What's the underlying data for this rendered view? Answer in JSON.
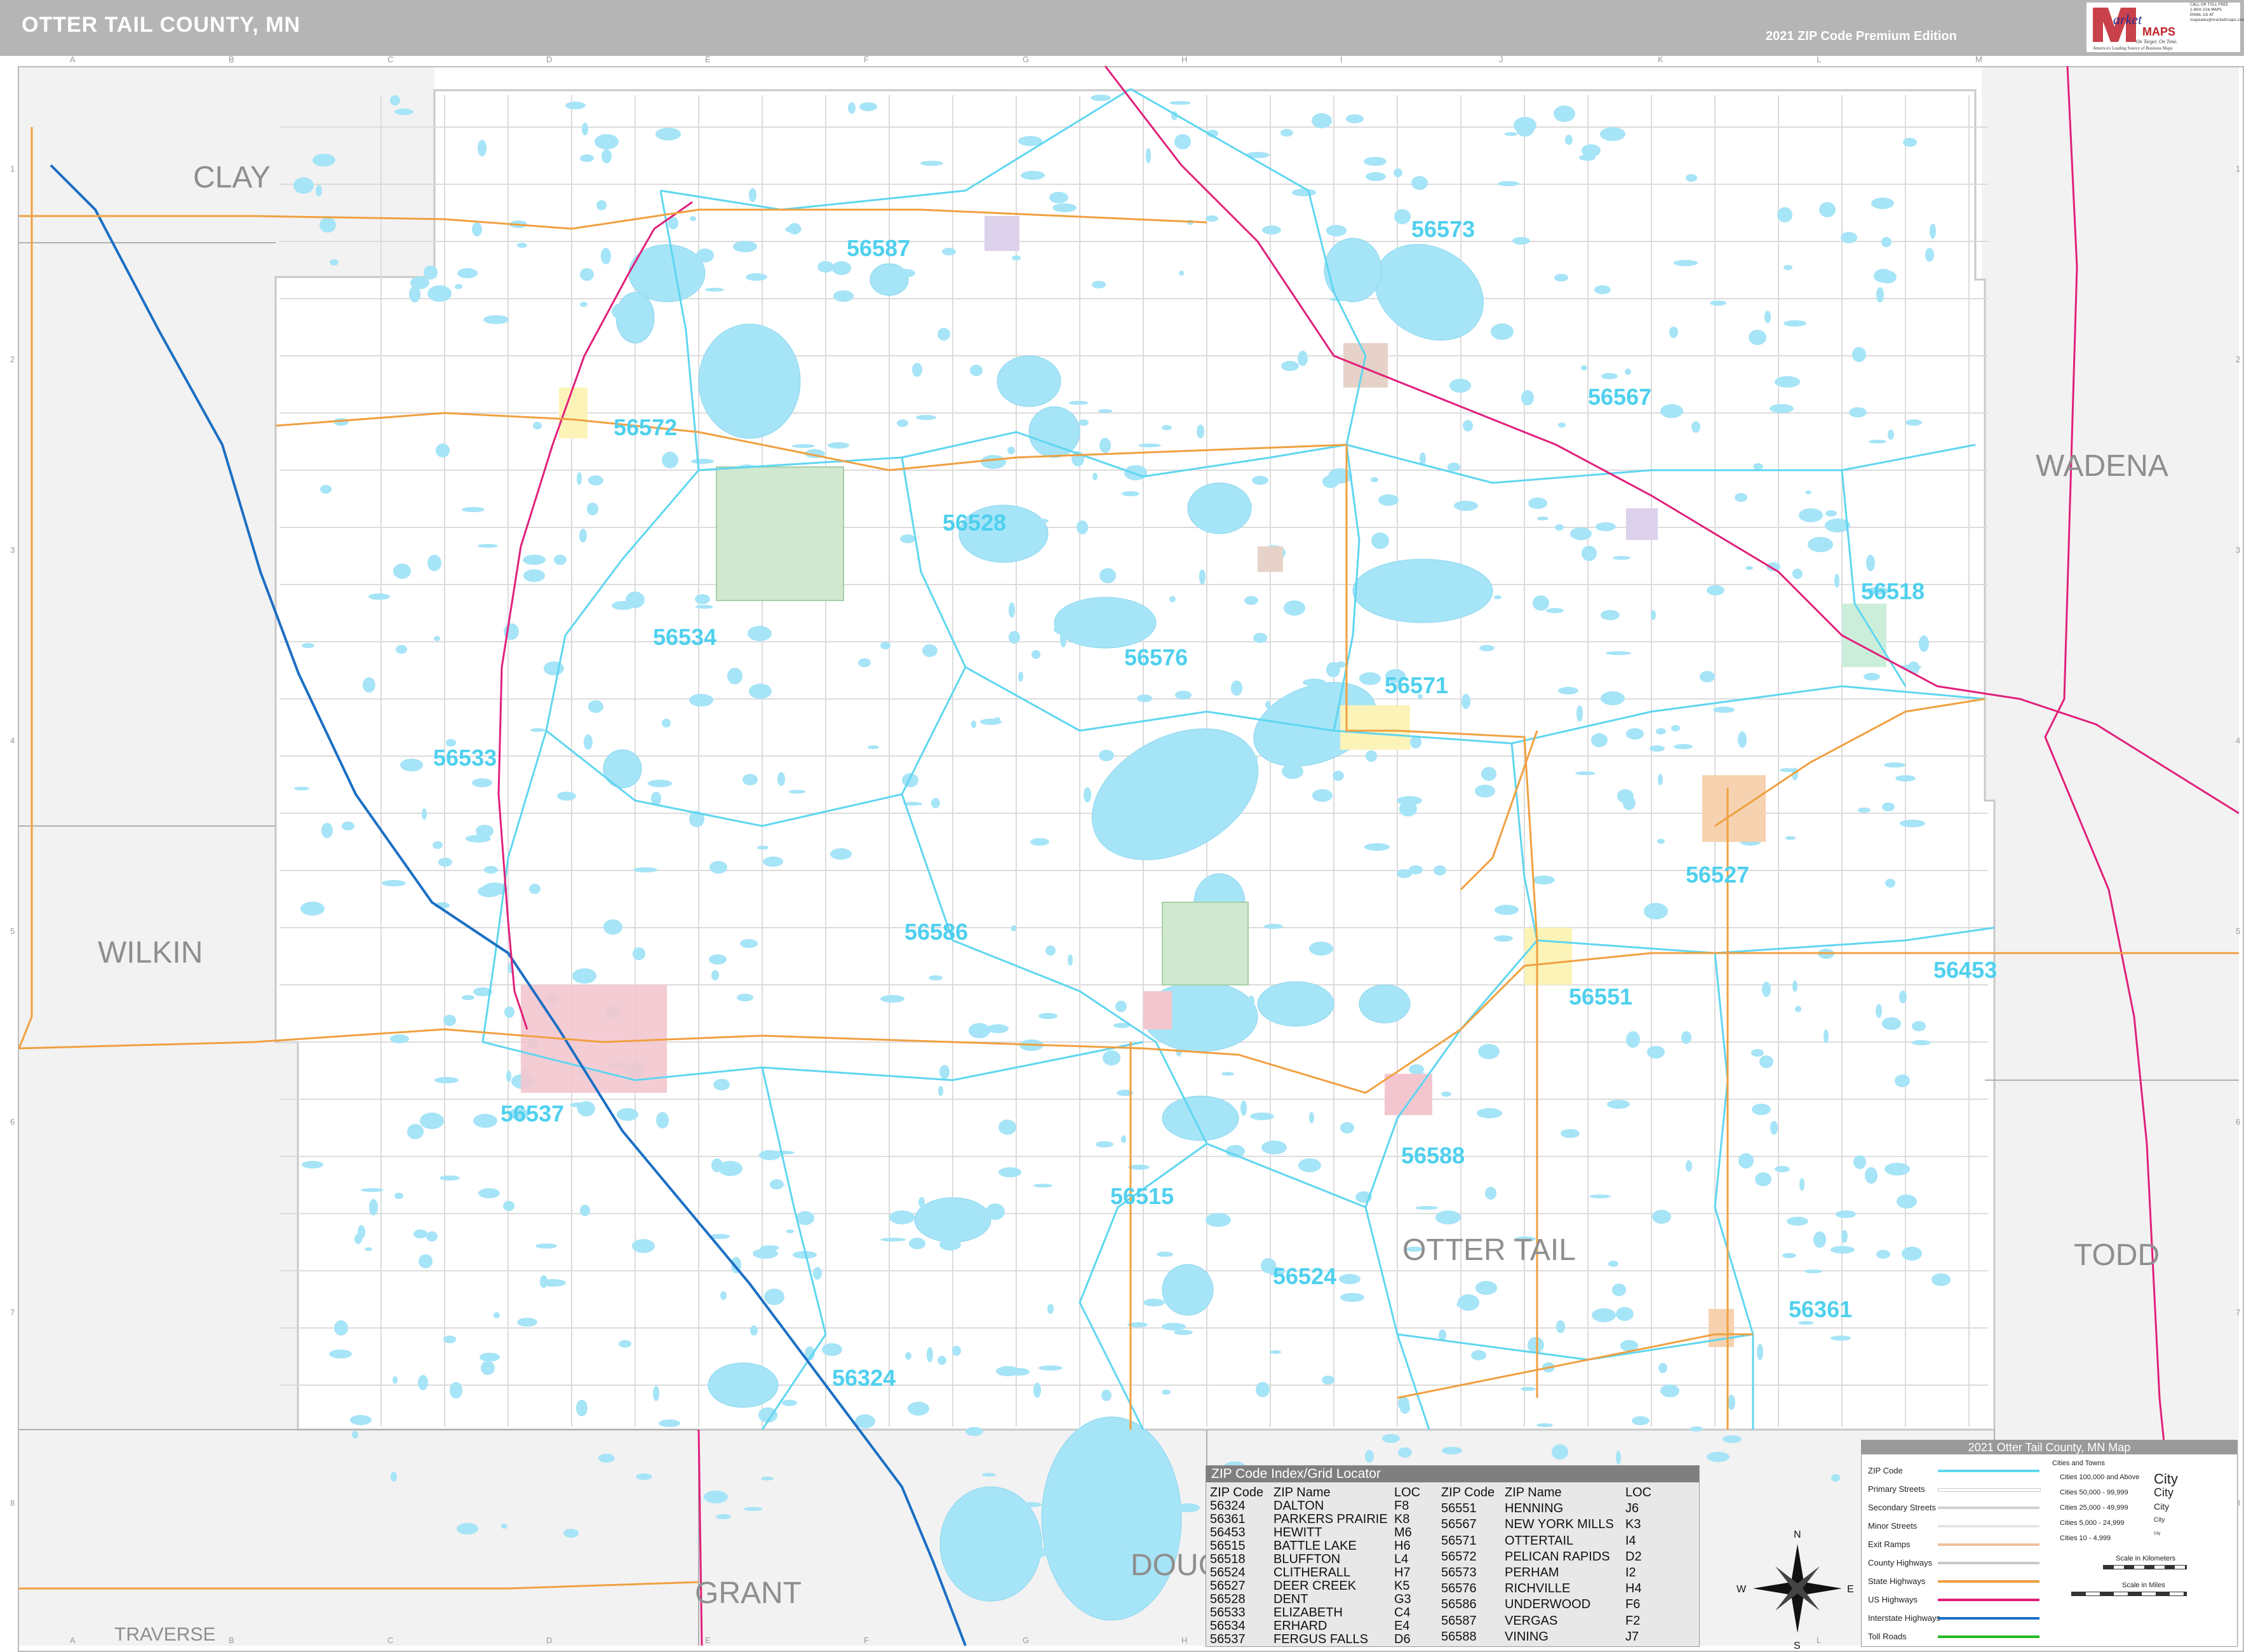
{
  "header": {
    "title": "OTTER TAIL COUNTY, MN",
    "edition": "2021 ZIP Code Premium Edition",
    "logo_text": "Market MAPS",
    "logo_tagline": "On Target. On Time.",
    "logo_sub": "America's Leading Source of Business Maps",
    "contact": [
      "CALL OR TOLL FREE",
      "1-800-334-MAPS",
      "EMAIL US AT",
      "mapsales@marketmaps.com"
    ]
  },
  "grid": {
    "columns": [
      "A",
      "B",
      "C",
      "D",
      "E",
      "F",
      "G",
      "H",
      "I",
      "J",
      "K",
      "L",
      "M"
    ],
    "rows": [
      "1",
      "2",
      "3",
      "4",
      "5",
      "6",
      "7",
      "8"
    ]
  },
  "counties": [
    {
      "name": "CLAY"
    },
    {
      "name": "WADENA"
    },
    {
      "name": "WILKIN"
    },
    {
      "name": "OTTER TAIL"
    },
    {
      "name": "TODD"
    },
    {
      "name": "GRANT"
    },
    {
      "name": "DOUG"
    },
    {
      "name": "TRAVERSE"
    }
  ],
  "zips": [
    {
      "code": "56587"
    },
    {
      "code": "56573"
    },
    {
      "code": "56572"
    },
    {
      "code": "56567"
    },
    {
      "code": "56528"
    },
    {
      "code": "56518"
    },
    {
      "code": "56534"
    },
    {
      "code": "56576"
    },
    {
      "code": "56571"
    },
    {
      "code": "56533"
    },
    {
      "code": "56527"
    },
    {
      "code": "56586"
    },
    {
      "code": "56453"
    },
    {
      "code": "56551"
    },
    {
      "code": "56537"
    },
    {
      "code": "56588"
    },
    {
      "code": "56515"
    },
    {
      "code": "56524"
    },
    {
      "code": "56361"
    },
    {
      "code": "56324"
    }
  ],
  "zip_index": {
    "title": "ZIP Code Index/Grid Locator",
    "headers": [
      "ZIP Code",
      "ZIP Name",
      "LOC"
    ],
    "left": [
      [
        "56324",
        "DALTON",
        "F8"
      ],
      [
        "56361",
        "PARKERS PRAIRIE",
        "K8"
      ],
      [
        "56453",
        "HEWITT",
        "M6"
      ],
      [
        "56515",
        "BATTLE LAKE",
        "H6"
      ],
      [
        "56518",
        "BLUFFTON",
        "L4"
      ],
      [
        "56524",
        "CLITHERALL",
        "H7"
      ],
      [
        "56527",
        "DEER CREEK",
        "K5"
      ],
      [
        "56528",
        "DENT",
        "G3"
      ],
      [
        "56533",
        "ELIZABETH",
        "C4"
      ],
      [
        "56534",
        "ERHARD",
        "E4"
      ],
      [
        "56537",
        "FERGUS FALLS",
        "D6"
      ]
    ],
    "right": [
      [
        "56551",
        "HENNING",
        "J6"
      ],
      [
        "56567",
        "NEW YORK MILLS",
        "K3"
      ],
      [
        "56571",
        "OTTERTAIL",
        "I4"
      ],
      [
        "56572",
        "PELICAN RAPIDS",
        "D2"
      ],
      [
        "56573",
        "PERHAM",
        "I2"
      ],
      [
        "56576",
        "RICHVILLE",
        "H4"
      ],
      [
        "56586",
        "UNDERWOOD",
        "F6"
      ],
      [
        "56587",
        "VERGAS",
        "F2"
      ],
      [
        "56588",
        "VINING",
        "J7"
      ]
    ]
  },
  "legend": {
    "title": "2021 Otter Tail County, MN Map",
    "cities_title": "Cities and Towns",
    "rows": [
      "ZIP Code",
      "Primary Streets",
      "Secondary Streets",
      "Minor Streets",
      "Exit Ramps",
      "County Highways",
      "State Highways",
      "US Highways",
      "Interstate Highways",
      "Toll Roads"
    ],
    "cities": [
      "Cities 100,000 and Above",
      "Cities 50,000 - 99,999",
      "Cities 25,000 - 49,999",
      "Cities 5,000 - 24,999",
      "Cities 10 - 4,999"
    ],
    "city_marks": [
      "City",
      "City",
      "City",
      "City",
      "City"
    ],
    "scale_km": "Scale in Kilometers",
    "scale_mi": "Scale in Miles",
    "colors": {
      "zip": "#5fd6f0",
      "county_hwy": "#c8c8c8",
      "state_hwy": "#f0a040",
      "us_hwy": "#e0207a",
      "interstate": "#1b6fc4",
      "toll": "#22bb22"
    }
  },
  "compass": {
    "n": "N",
    "s": "S",
    "e": "E",
    "w": "W"
  },
  "colors": {
    "water": "#a6e4f7",
    "zip_line": "#5fd6f0",
    "border": "#a0a0a0",
    "outside": "#f2f2f2"
  }
}
